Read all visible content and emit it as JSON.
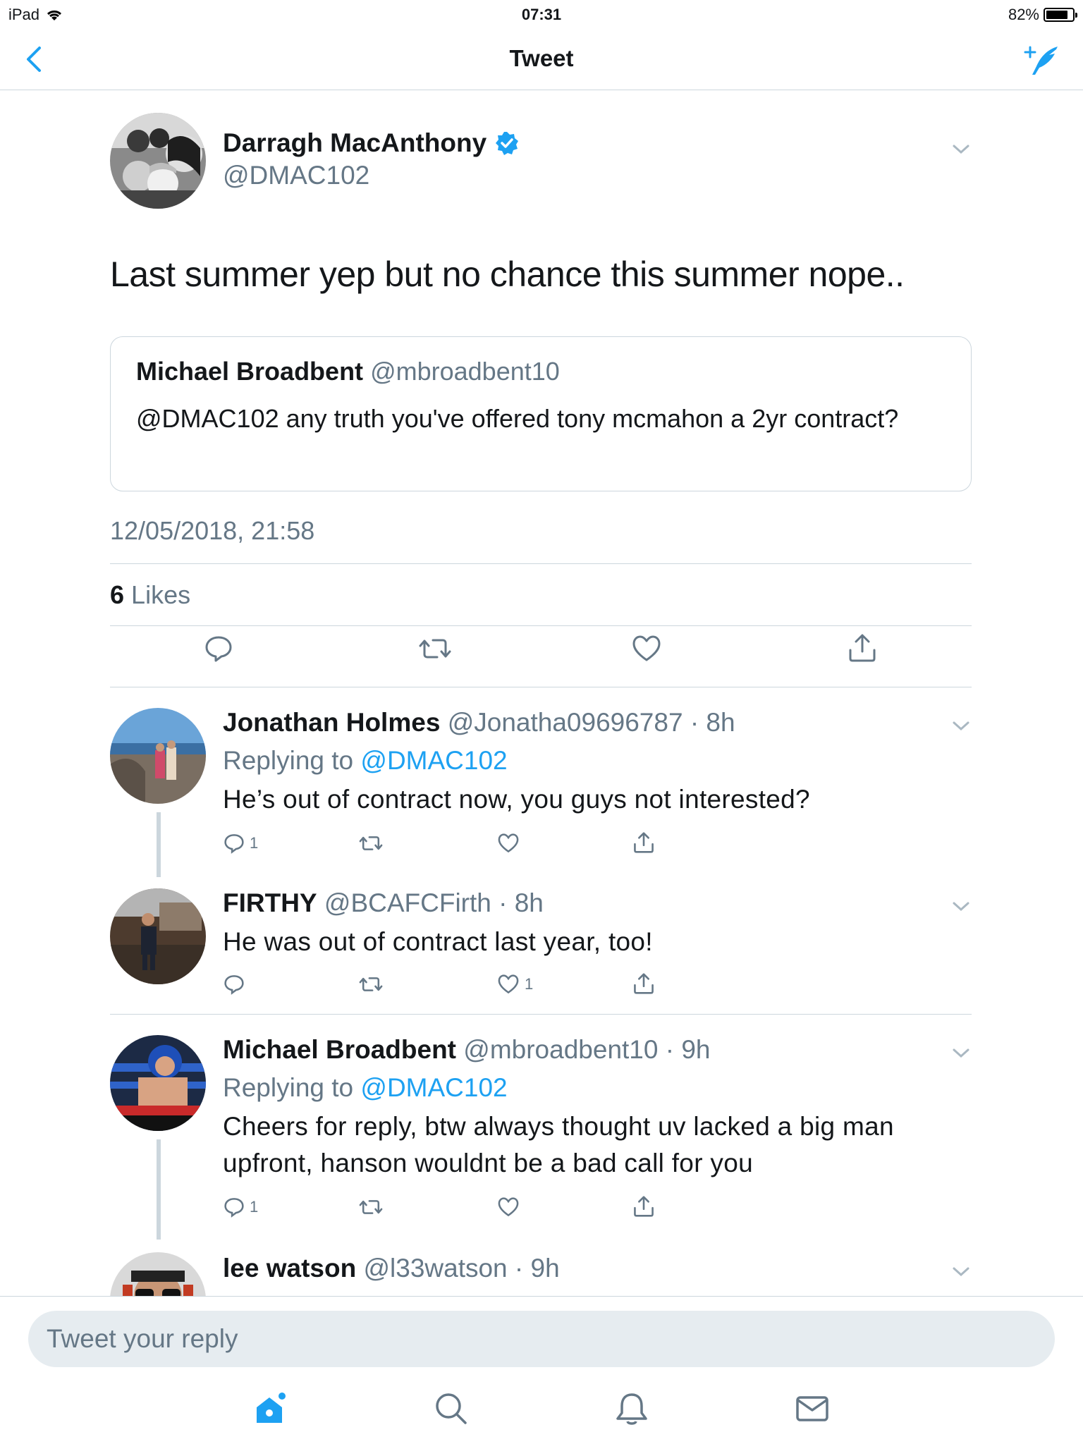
{
  "status_bar": {
    "device": "iPad",
    "time": "07:31",
    "battery": "82%",
    "battery_level": 0.82
  },
  "nav": {
    "title": "Tweet"
  },
  "main_tweet": {
    "name": "Darragh MacAnthony",
    "handle": "@DMAC102",
    "text": "Last summer yep but no chance this summer nope..",
    "quote": {
      "name": "Michael Broadbent",
      "handle": "@mbroadbent10",
      "text": "@DMAC102 any truth you've offered tony mcmahon a 2yr contract?"
    },
    "date": "12/05/2018, 21:58",
    "likes_count": "6",
    "likes_label": "Likes"
  },
  "replies": [
    {
      "name": "Jonathan Holmes",
      "meta": "@Jonatha09696787 · 8h",
      "replying_prefix": "Replying to",
      "replying_to": "@DMAC102",
      "text": "He’s out of contract now, you guys not interested?",
      "reply_count": "1",
      "like_count": ""
    },
    {
      "name": "FIRTHY",
      "meta": "@BCAFCFirth · 8h",
      "text": "He was out of contract last year, too!",
      "reply_count": "",
      "like_count": "1"
    },
    {
      "name": "Michael Broadbent",
      "meta": "@mbroadbent10 · 9h",
      "replying_prefix": "Replying to",
      "replying_to": "@DMAC102",
      "text": "Cheers for reply, btw always thought uv lacked a big man upfront, hanson wouldnt be a bad call for you",
      "reply_count": "1",
      "like_count": ""
    },
    {
      "name": "lee watson",
      "meta": "@l33watson · 9h"
    }
  ],
  "compose": {
    "placeholder": "Tweet your reply"
  },
  "colors": {
    "accent": "#1da1f2",
    "muted": "#657786",
    "border": "#ccd6dd",
    "text": "#14171a"
  },
  "tabbar": {
    "items": [
      "home-icon",
      "search-icon",
      "notifications-icon",
      "messages-icon"
    ]
  }
}
